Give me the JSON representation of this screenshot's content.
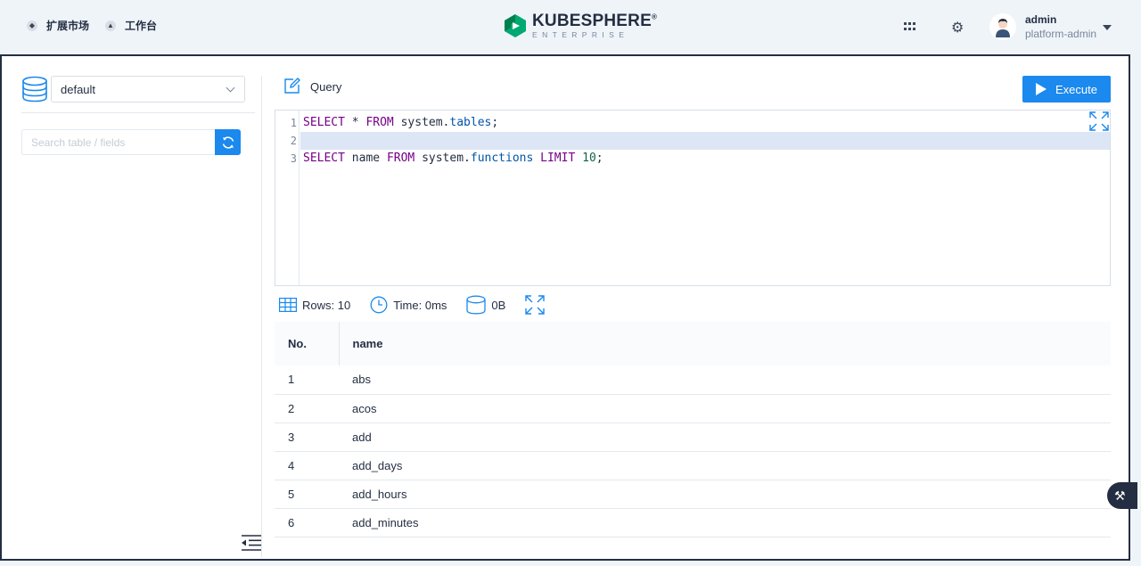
{
  "topbar": {
    "market_label": "扩展市场",
    "workbench_label": "工作台",
    "logo_title": "KUBESPHERE",
    "logo_registered": "®",
    "logo_subtitle": "ENTERPRISE",
    "user_name": "admin",
    "user_role": "platform-admin",
    "icons": [
      "market-icon",
      "workbench-icon",
      "apps-grid-icon",
      "gear-icon",
      "avatar",
      "caret-down-icon"
    ]
  },
  "sidebar": {
    "database_value": "default",
    "search_placeholder": "Search table / fields"
  },
  "query": {
    "title": "Query",
    "execute_label": "Execute"
  },
  "editor": {
    "lines": [
      {
        "number": "1",
        "text": "SELECT * FROM system.tables;"
      },
      {
        "number": "2",
        "text": ""
      },
      {
        "number": "3",
        "text": "SELECT name FROM system.functions LIMIT 10;"
      }
    ],
    "active_line": 2
  },
  "stats": {
    "rows": "Rows: 10",
    "time": "Time: 0ms",
    "size": "0B"
  },
  "results": {
    "columns": [
      "No.",
      "name"
    ],
    "rows": [
      {
        "no": "1",
        "name": "abs"
      },
      {
        "no": "2",
        "name": "acos"
      },
      {
        "no": "3",
        "name": "add"
      },
      {
        "no": "4",
        "name": "add_days"
      },
      {
        "no": "5",
        "name": "add_hours"
      },
      {
        "no": "6",
        "name": "add_minutes"
      }
    ]
  },
  "colors": {
    "accent": "#1b89ed",
    "text": "#242e42",
    "logo_green": "#00a971",
    "active_line": "#dde6f5"
  }
}
